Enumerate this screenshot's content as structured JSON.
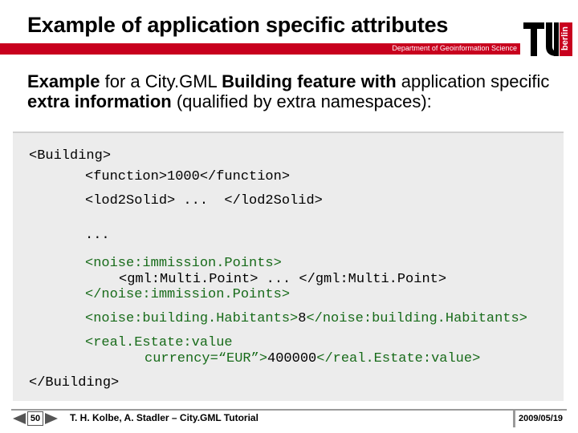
{
  "header": {
    "title": "Example of application specific attributes",
    "department": "Department of Geoinformation Science",
    "logo_text": "berlin"
  },
  "intro": {
    "part1": "Example",
    "part2": " for a City.GML ",
    "part3": "Building feature with",
    "part4": " application specific ",
    "part5": "extra information",
    "part6": " (qualified by extra namespaces):"
  },
  "code": {
    "line1": "<Building>",
    "line2": "<function>1000</function>",
    "line3": "<lod2Solid> ...  </lod2Solid>",
    "line4": "...",
    "line5": "<noise:immission.Points>",
    "line6": "<gml:Multi.Point> ... </gml:Multi.Point>",
    "line7": "</noise:immission.Points>",
    "line8a": "<noise:building.Habitants>",
    "line8b": "8",
    "line8c": "</noise:building.Habitants>",
    "line9": "<real.Estate:value",
    "line10a": "currency=“EUR”>",
    "line10b": "400000",
    "line10c": "</real.Estate:value>",
    "line11": "</Building>"
  },
  "footer": {
    "page_number": "50",
    "author": "T. H. Kolbe, A. Stadler – City.GML Tutorial",
    "date": "2009/05/19"
  },
  "colors": {
    "accent_red": "#c8001e",
    "code_green": "#186b1a",
    "code_bg": "#ececec"
  },
  "icons": {
    "prev": "left-triangle-icon",
    "next": "right-triangle-icon",
    "logo": "tu-berlin-logo"
  }
}
